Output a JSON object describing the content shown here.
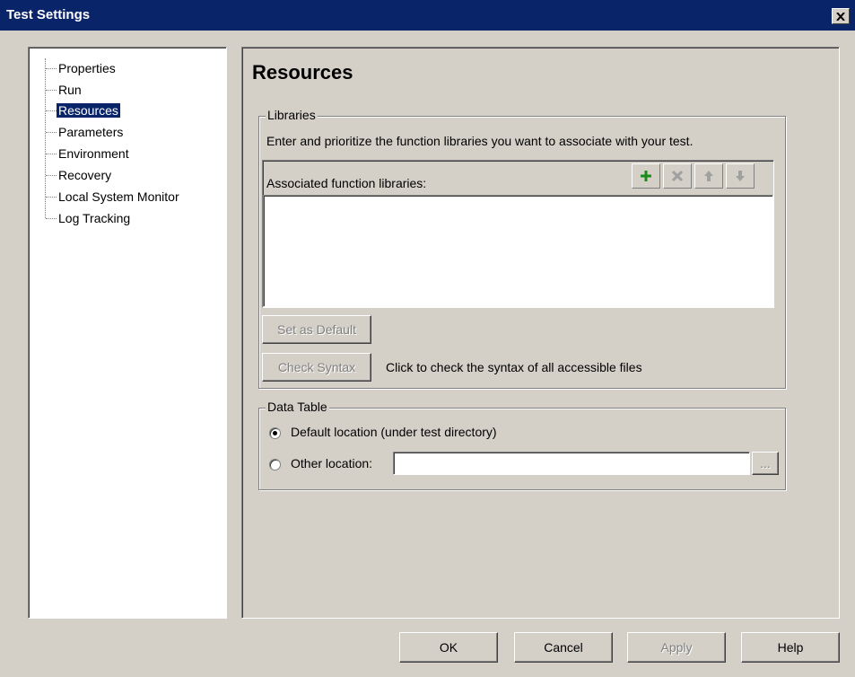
{
  "window": {
    "title": "Test Settings"
  },
  "tree": {
    "items": [
      {
        "label": "Properties",
        "selected": false
      },
      {
        "label": "Run",
        "selected": false
      },
      {
        "label": "Resources",
        "selected": true
      },
      {
        "label": "Parameters",
        "selected": false
      },
      {
        "label": "Environment",
        "selected": false
      },
      {
        "label": "Recovery",
        "selected": false
      },
      {
        "label": "Local System Monitor",
        "selected": false
      },
      {
        "label": "Log Tracking",
        "selected": false
      }
    ]
  },
  "page": {
    "title": "Resources",
    "libraries": {
      "legend": "Libraries",
      "description": "Enter and prioritize the function libraries you want to associate with your test.",
      "list_label": "Associated function libraries:",
      "set_default_label": "Set as Default",
      "check_syntax_label": "Check Syntax",
      "check_syntax_hint": "Click to check the syntax of all accessible files",
      "toolbar_icons": [
        "add-icon",
        "delete-icon",
        "move-up-icon",
        "move-down-icon"
      ],
      "items": []
    },
    "data_table": {
      "legend": "Data Table",
      "default_option": "Default location (under test directory)",
      "other_option": "Other location:",
      "selected": "default",
      "other_value": "",
      "browse_label": "..."
    }
  },
  "footer": {
    "ok": "OK",
    "cancel": "Cancel",
    "apply": "Apply",
    "help": "Help"
  },
  "colors": {
    "titlebar": "#0a246a",
    "face": "#d4d0c8",
    "add_icon": "#1a8a1a"
  }
}
